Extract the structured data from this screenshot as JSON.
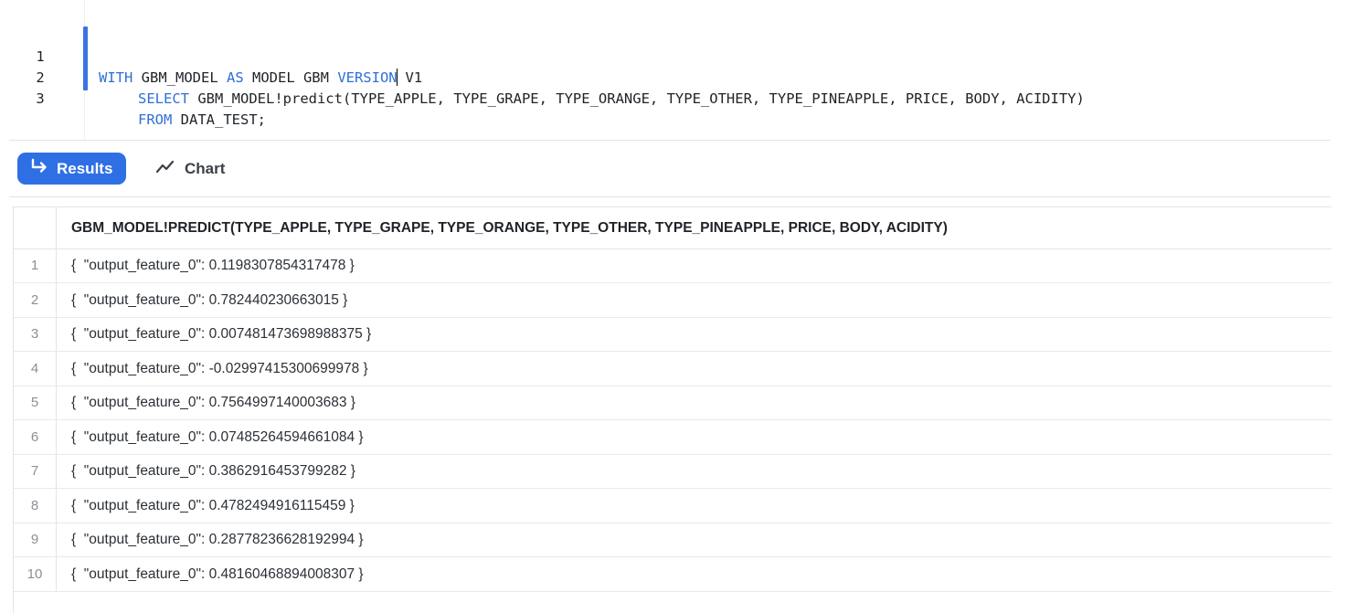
{
  "editor": {
    "lines": [
      {
        "num": "1",
        "tokens": [
          {
            "t": "WITH",
            "kw": true
          },
          {
            "t": " GBM_MODEL ",
            "kw": false
          },
          {
            "t": "AS",
            "kw": true
          },
          {
            "t": " MODEL GBM ",
            "kw": false
          },
          {
            "t": "VERSION",
            "kw": true
          },
          {
            "t": "CURSOR"
          },
          {
            "t": " V1",
            "kw": false
          }
        ]
      },
      {
        "num": "2",
        "tokens": [
          {
            "t": "SELECT",
            "kw": true
          },
          {
            "t": " GBM_MODEL!predict(TYPE_APPLE, TYPE_GRAPE, TYPE_ORANGE, TYPE_OTHER, TYPE_PINEAPPLE, PRICE, BODY, ACIDITY)",
            "kw": false
          }
        ]
      },
      {
        "num": "3",
        "tokens": [
          {
            "t": "FROM",
            "kw": true
          },
          {
            "t": " DATA_TEST;",
            "kw": false
          }
        ]
      }
    ]
  },
  "tabs": {
    "results_label": "Results",
    "chart_label": "Chart"
  },
  "table": {
    "column_header": "GBM_MODEL!PREDICT(TYPE_APPLE, TYPE_GRAPE, TYPE_ORANGE, TYPE_OTHER, TYPE_PINEAPPLE, PRICE, BODY, ACIDITY)",
    "rows": [
      {
        "index": "1",
        "value": "{  \"output_feature_0\": 0.1198307854317478 }"
      },
      {
        "index": "2",
        "value": "{  \"output_feature_0\": 0.782440230663015 }"
      },
      {
        "index": "3",
        "value": "{  \"output_feature_0\": 0.007481473698988375 }"
      },
      {
        "index": "4",
        "value": "{  \"output_feature_0\": -0.02997415300699978 }"
      },
      {
        "index": "5",
        "value": "{  \"output_feature_0\": 0.7564997140003683 }"
      },
      {
        "index": "6",
        "value": "{  \"output_feature_0\": 0.07485264594661084 }"
      },
      {
        "index": "7",
        "value": "{  \"output_feature_0\": 0.3862916453799282 }"
      },
      {
        "index": "8",
        "value": "{  \"output_feature_0\": 0.4782494916115459 }"
      },
      {
        "index": "9",
        "value": "{  \"output_feature_0\": 0.28778236628192994 }"
      },
      {
        "index": "10",
        "value": "{  \"output_feature_0\": 0.48160468894008307 }"
      }
    ]
  },
  "icons": {
    "results": "return-arrow-icon",
    "chart": "line-chart-icon"
  },
  "colors": {
    "accent": "#2f6fe4",
    "keyword": "#2f6fd6",
    "active_line_bar": "#3a74e0"
  }
}
